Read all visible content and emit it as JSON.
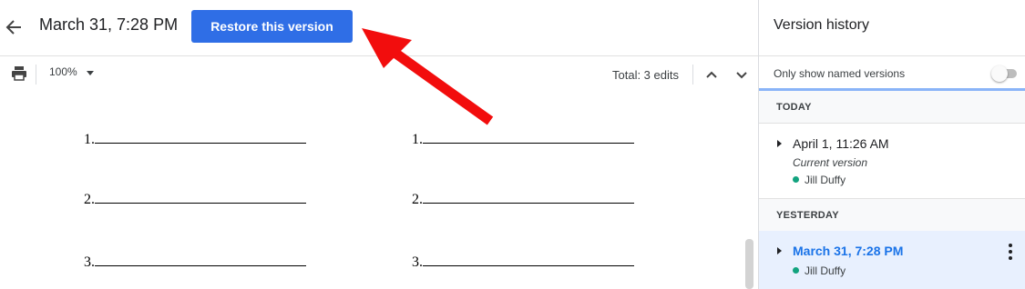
{
  "header": {
    "title": "March 31, 7:28 PM",
    "restore_label": "Restore this version"
  },
  "toolbar": {
    "print_icon": "print-icon",
    "zoom": "100%",
    "total_edits": "Total: 3 edits"
  },
  "document": {
    "lines": [
      {
        "number": "1."
      },
      {
        "number": "2."
      },
      {
        "number": "3."
      },
      {
        "number": "1."
      },
      {
        "number": "2."
      },
      {
        "number": "3."
      }
    ]
  },
  "sidebar": {
    "title": "Version history",
    "named_only_label": "Only show named versions",
    "named_only_enabled": false,
    "sections": [
      {
        "label": "TODAY",
        "entries": [
          {
            "title": "April 1, 11:26 AM",
            "subtitle": "Current version",
            "user": "Jill Duffy",
            "user_color": "#12a37f",
            "selected": false
          }
        ]
      },
      {
        "label": "YESTERDAY",
        "entries": [
          {
            "title": "March 31, 7:28 PM",
            "user": "Jill Duffy",
            "user_color": "#12a37f",
            "selected": true
          }
        ]
      }
    ]
  },
  "colors": {
    "accent": "#2f6ee6",
    "selected_bg": "#e8f0fe",
    "annotation_arrow": "#f20d0d"
  }
}
